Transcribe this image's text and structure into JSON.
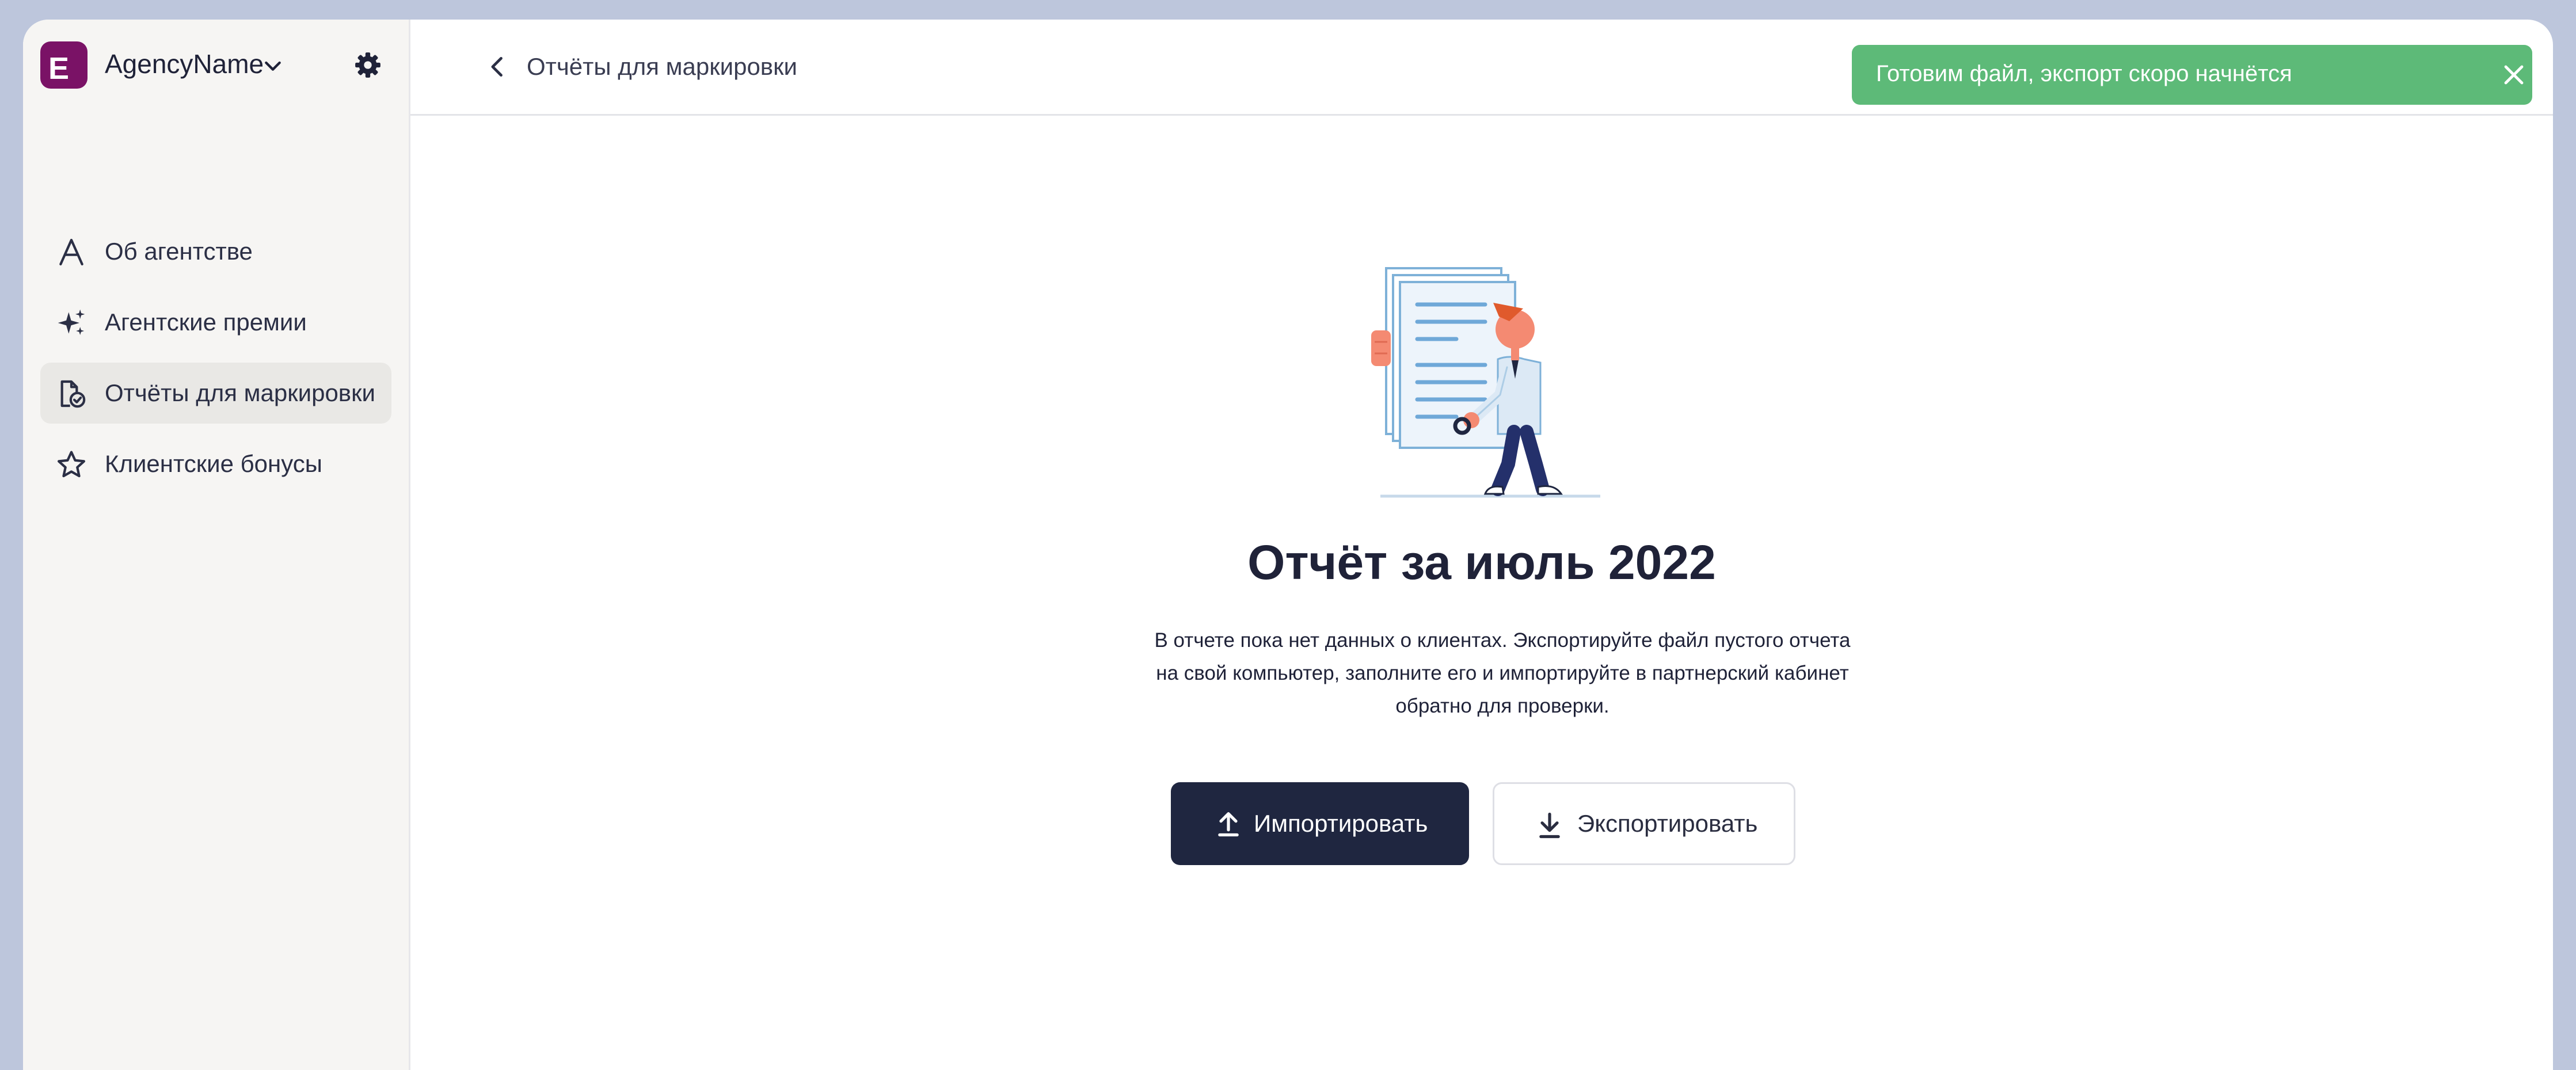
{
  "app": {
    "agency_name": "AgencyName",
    "logo_letter": "E",
    "brand_color": "#7a1266"
  },
  "sidebar": {
    "items": [
      {
        "label": "Об агентстве",
        "icon": "letter-a-icon",
        "active": false
      },
      {
        "label": "Агентские премии",
        "icon": "sparkles-icon",
        "active": false
      },
      {
        "label": "Отчёты для маркировки",
        "icon": "document-check-icon",
        "active": true
      },
      {
        "label": "Клиентские бонусы",
        "icon": "star-icon",
        "active": false
      }
    ]
  },
  "header": {
    "breadcrumb": "Отчёты для маркировки"
  },
  "toast": {
    "message": "Готовим файл, экспорт скоро начнётся",
    "color": "#5dba78"
  },
  "main": {
    "title": "Отчёт за июль 2022",
    "description": "В отчете пока нет данных о клиентах. Экспортируйте файл пустого отчета на свой компьютер, заполните его и импортируйте в партнерский кабинет обратно для проверки.",
    "import_label": "Импортировать",
    "export_label": "Экспортировать",
    "primary_color": "#1f2640"
  }
}
